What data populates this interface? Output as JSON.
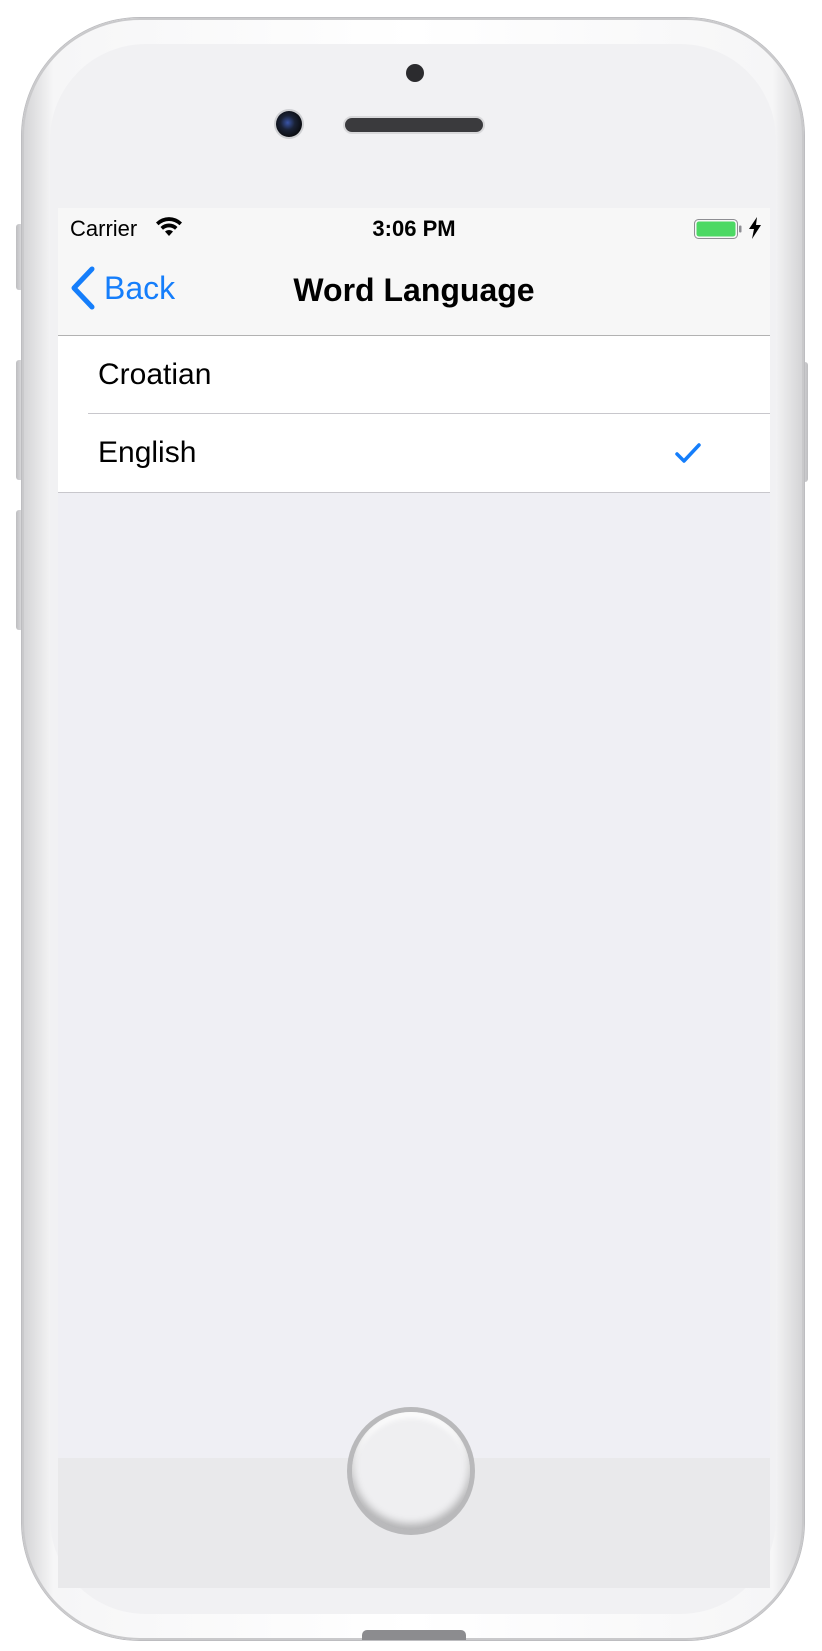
{
  "status_bar": {
    "carrier": "Carrier",
    "time": "3:06 PM"
  },
  "nav_bar": {
    "back_label": "Back",
    "title": "Word Language"
  },
  "languages": [
    {
      "label": "Croatian",
      "selected": false
    },
    {
      "label": "English",
      "selected": true
    }
  ],
  "colors": {
    "accent": "#157efb",
    "battery": "#4cd964",
    "background": "#efeff4",
    "separator": "#c8c7cc"
  },
  "icons": {
    "wifi": "wifi-icon",
    "battery": "battery-icon",
    "charging": "charging-bolt-icon",
    "back": "back-chevron-icon",
    "selected": "checkmark-icon"
  }
}
